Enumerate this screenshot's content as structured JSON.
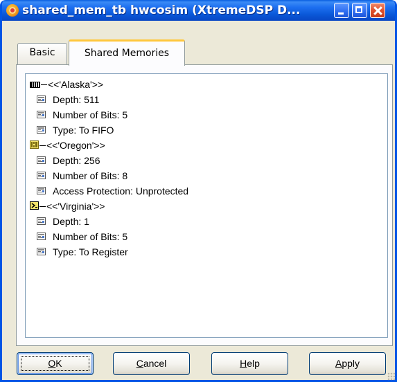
{
  "window": {
    "title": "shared_mem_tb hwcosim (XtremeDSP D..."
  },
  "tabs": [
    {
      "label": "Basic",
      "active": false
    },
    {
      "label": "Shared Memories",
      "active": true
    }
  ],
  "tree": [
    {
      "label": "<<'Alaska'>>",
      "icon": "fifo-memory-icon",
      "children": [
        {
          "label": "Depth: 511"
        },
        {
          "label": "Number of Bits: 5"
        },
        {
          "label": "Type: To FIFO"
        }
      ]
    },
    {
      "label": "<<'Oregon'>>",
      "icon": "shared-memory-icon",
      "children": [
        {
          "label": "Depth: 256"
        },
        {
          "label": "Number of Bits: 8"
        },
        {
          "label": "Access Protection: Unprotected"
        }
      ]
    },
    {
      "label": "<<'Virginia'>>",
      "icon": "register-icon",
      "children": [
        {
          "label": "Depth: 1"
        },
        {
          "label": "Number of Bits: 5"
        },
        {
          "label": "Type: To Register"
        }
      ]
    }
  ],
  "buttons": {
    "ok": {
      "mnemonic": "O",
      "rest": "K"
    },
    "cancel": {
      "mnemonic": "C",
      "rest": "ancel"
    },
    "help": {
      "mnemonic": "H",
      "rest": "elp"
    },
    "apply": {
      "mnemonic": "A",
      "rest": "pply"
    }
  },
  "colors": {
    "titlebar": "#0a58d8",
    "dialog_face": "#ece9d8",
    "active_tab_highlight": "#ffc73c"
  }
}
